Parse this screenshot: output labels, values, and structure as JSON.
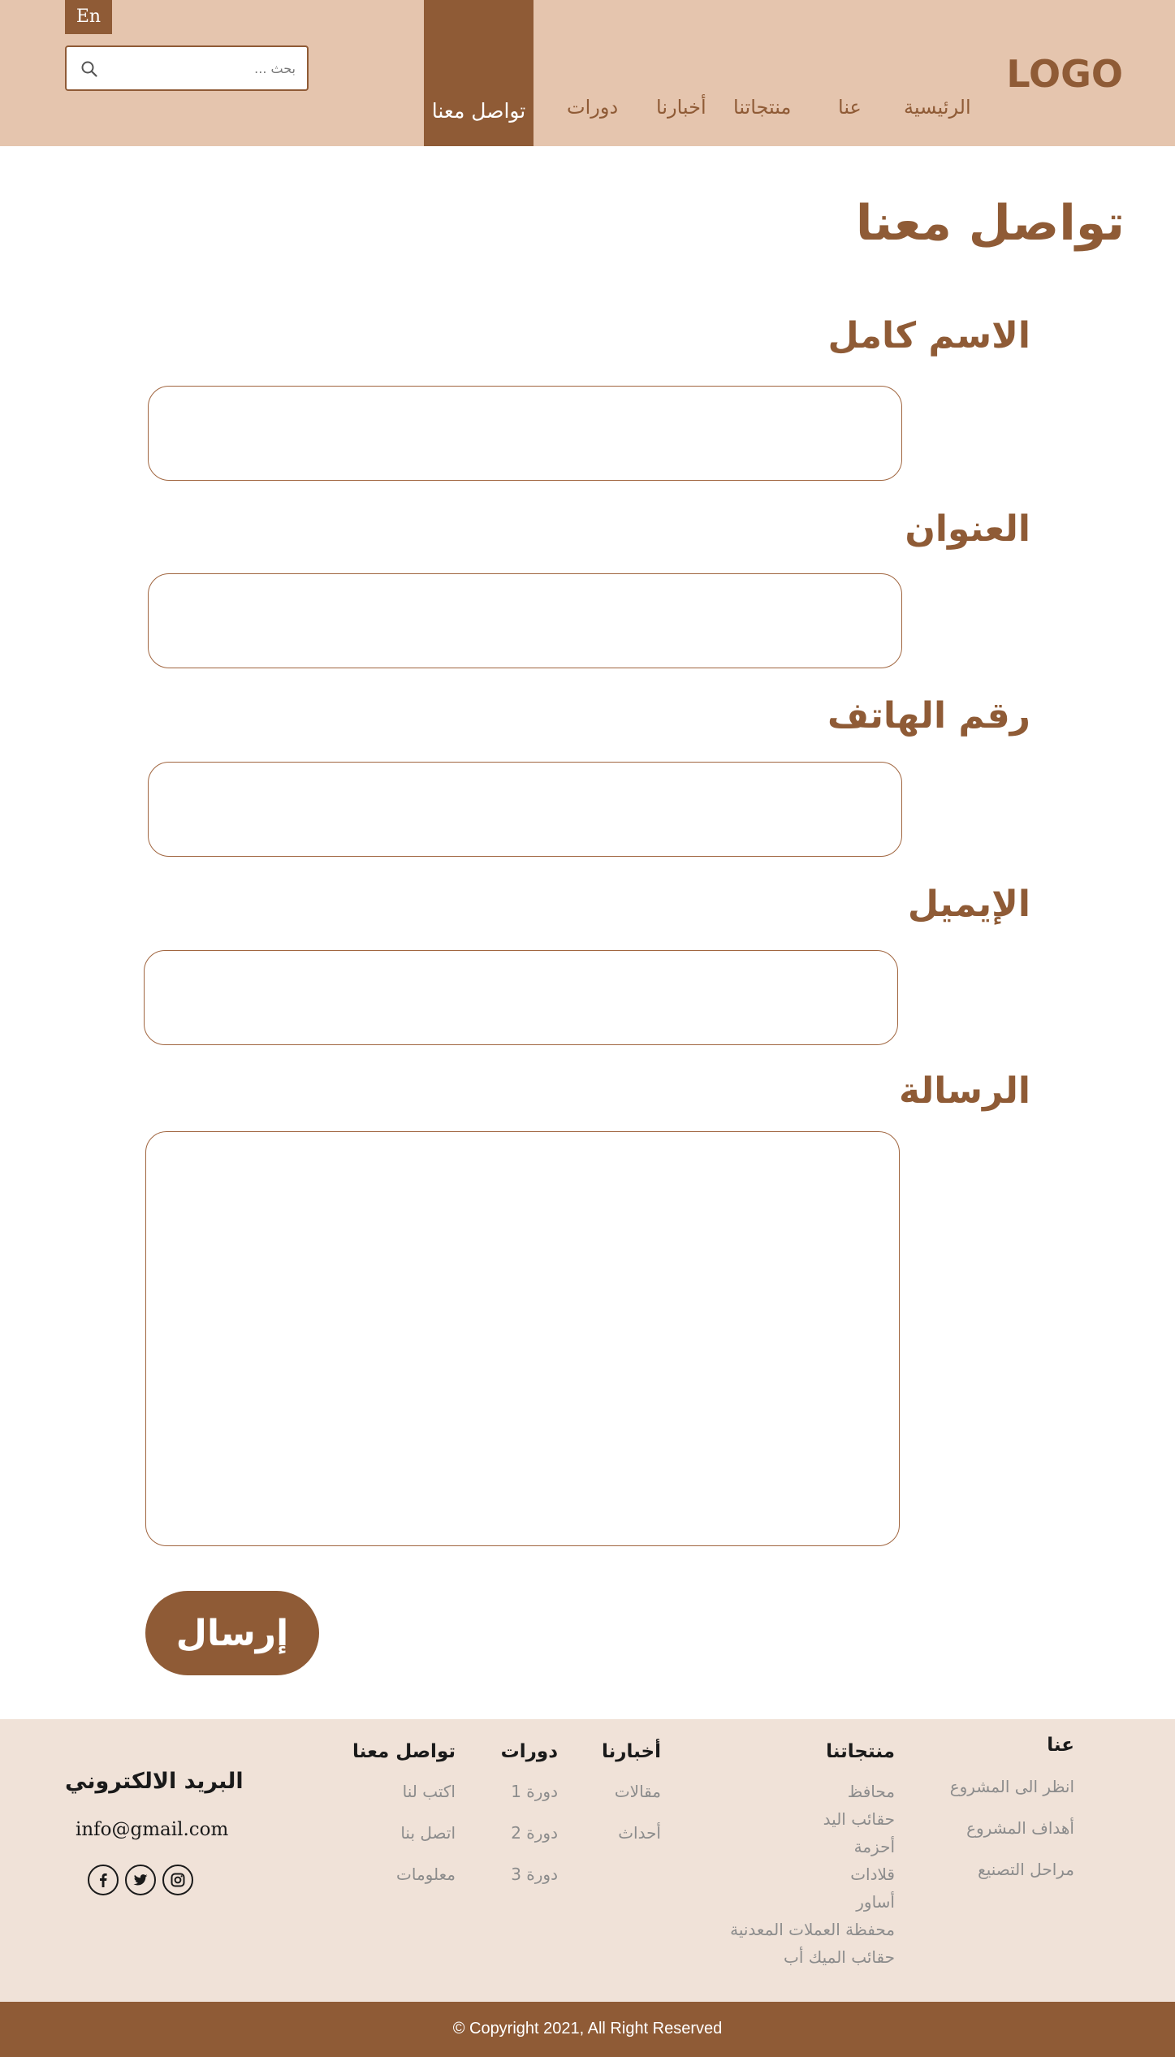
{
  "header": {
    "lang": "En",
    "search_placeholder": "بحث ...",
    "logo": "LOGO",
    "nav": {
      "home": "الرئيسية",
      "about": "عنا",
      "products": "منتجاتنا",
      "news": "أخبارنا",
      "courses": "دورات",
      "contact": "تواصل معنا"
    }
  },
  "page": {
    "title": "تواصل معنا"
  },
  "form": {
    "full_name_label": "الاسم كامل",
    "address_label": "العنوان",
    "phone_label": "رقم الهاتف",
    "email_label": "الإيميل",
    "message_label": "الرسالة",
    "submit_label": "إرسال"
  },
  "footer": {
    "about": {
      "title": "عنا",
      "links": [
        "انظر الى المشروع",
        "أهداف المشروع",
        "مراحل التصنيع"
      ]
    },
    "products": {
      "title": "منتجاتنا",
      "links": [
        "محافظ",
        "حقائب اليد",
        "أحزمة",
        "قلادات",
        "أساور",
        "محفظة العملات المعدنية",
        "حقائب الميك أب"
      ]
    },
    "news": {
      "title": "أخبارنا",
      "links": [
        "مقالات",
        "أحداث"
      ]
    },
    "courses": {
      "title": "دورات",
      "links": [
        "دورة 1",
        "دورة 2",
        "دورة 3"
      ]
    },
    "contact": {
      "title": "تواصل معنا",
      "links": [
        "اكتب لنا",
        "اتصل بنا",
        "معلومات"
      ]
    },
    "email_title": "البريد الالكتروني",
    "email_value": "info@gmail.com",
    "social_icons": [
      "facebook-icon",
      "twitter-icon",
      "instagram-icon"
    ]
  },
  "copyright": "© Copyright 2021, All Right Reserved",
  "colors": {
    "header_bg": "#e5c5ae",
    "brand_brown": "#8f5b36",
    "footer_bg": "#f0e2d8"
  }
}
